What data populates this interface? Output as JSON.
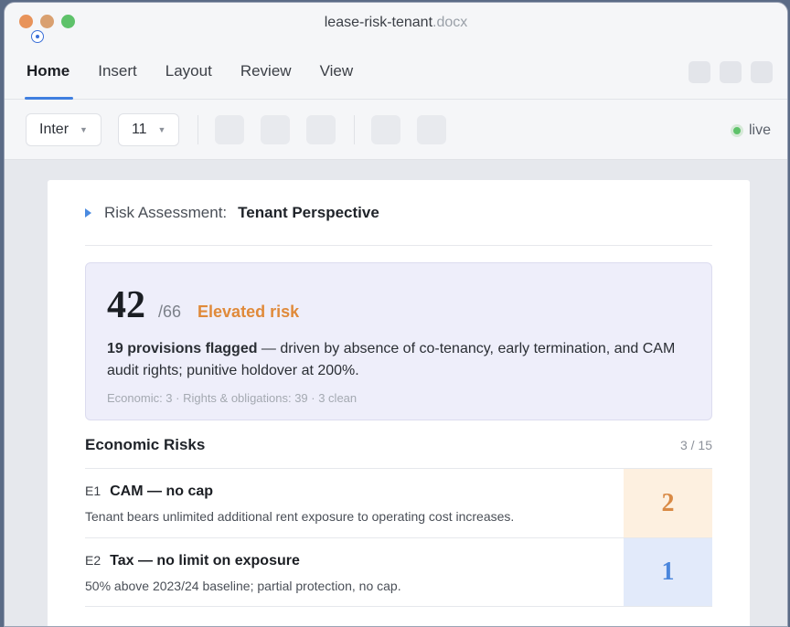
{
  "window": {
    "title": "lease-risk-tenant",
    "extension": ".docx"
  },
  "ribbon": {
    "tabs": [
      {
        "label": "Home",
        "active": true
      },
      {
        "label": "Insert",
        "active": false
      },
      {
        "label": "Layout",
        "active": false
      },
      {
        "label": "Review",
        "active": false
      },
      {
        "label": "View",
        "active": false
      }
    ]
  },
  "toolbar": {
    "font": "Inter",
    "size": "11",
    "status": "live"
  },
  "document": {
    "section_label": "Risk Assessment:",
    "section_value": "Tenant Perspective",
    "summary": {
      "score": "42",
      "max": "/66",
      "level": "Elevated risk",
      "headline": "19 provisions flagged",
      "detail": " — driven by absence of co-tenancy, early termination, and CAM audit rights; punitive holdover at 200%.",
      "meta": "Economic: 3 · Rights & obligations: 39 · 3 clean"
    },
    "economic": {
      "title": "Economic Risks",
      "count": "3 / 15",
      "items": [
        {
          "code": "E1",
          "title": "CAM — no cap",
          "desc": "Tenant bears unlimited additional rent exposure to operating cost increases.",
          "score": "2"
        },
        {
          "code": "E2",
          "title": "Tax — no limit on exposure",
          "desc": "50% above 2023/24 baseline; partial protection, no cap.",
          "score": "1"
        }
      ]
    }
  },
  "colors": {
    "accent": "#3f7fe0",
    "elevated": "#e08a3a",
    "live": "#5ec26a"
  }
}
